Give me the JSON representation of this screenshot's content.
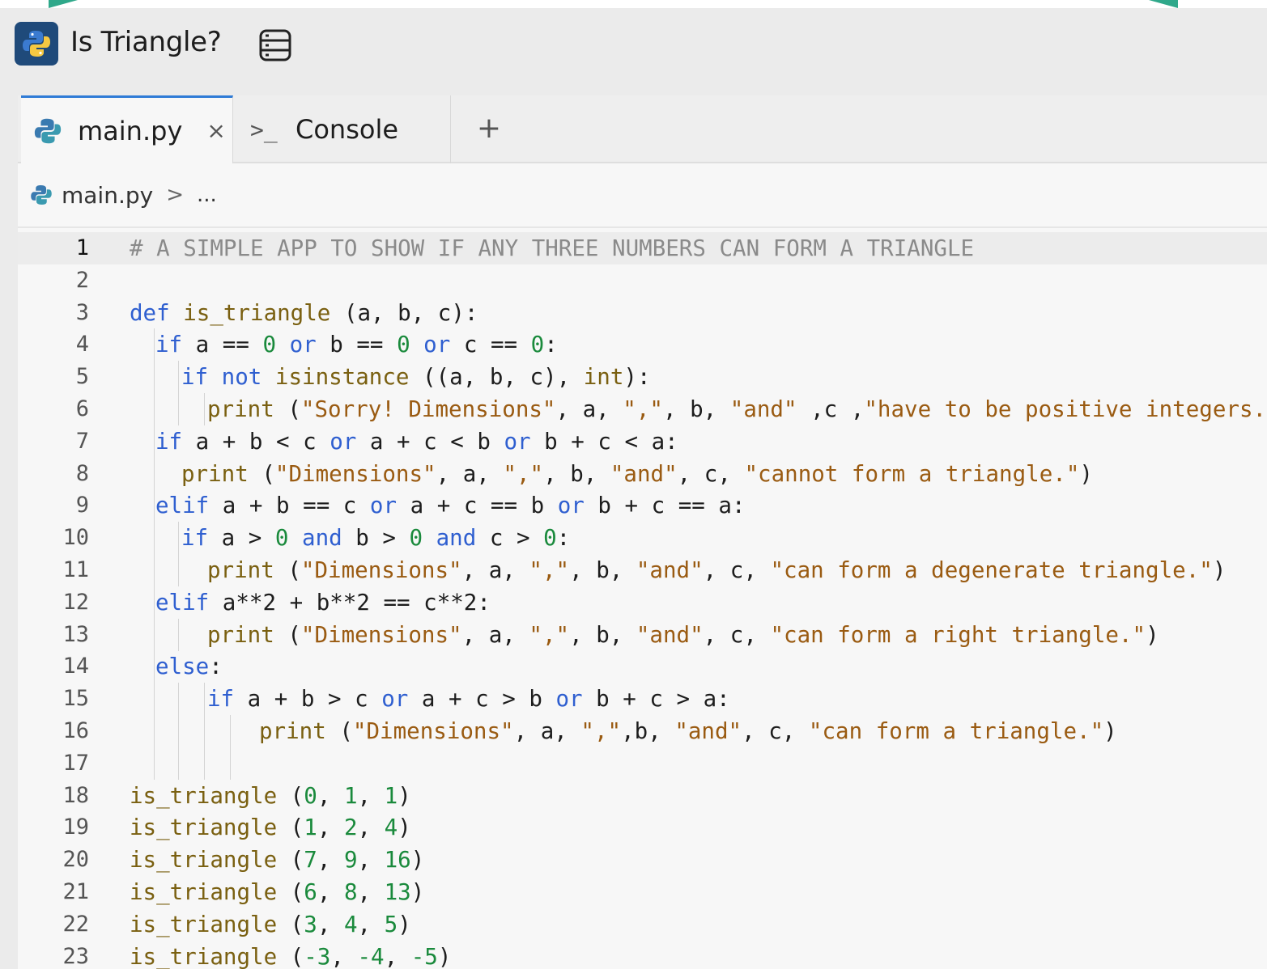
{
  "app": {
    "title": "Is Triangle?"
  },
  "tabs": [
    {
      "label": "main.py",
      "active": true,
      "close": "×"
    },
    {
      "label": "Console",
      "active": false,
      "icon_text": ">_"
    }
  ],
  "add_tab_label": "+",
  "breadcrumb": {
    "file": "main.py",
    "separator": ">",
    "more": "..."
  },
  "editor": {
    "current_line": 1,
    "lines": [
      {
        "n": "1",
        "indent": 0,
        "guides": 0,
        "tokens": [
          [
            "cm",
            "# A SIMPLE APP TO SHOW IF ANY THREE NUMBERS CAN FORM A TRIANGLE"
          ]
        ]
      },
      {
        "n": "2",
        "indent": 0,
        "guides": 0,
        "tokens": []
      },
      {
        "n": "3",
        "indent": 0,
        "guides": 0,
        "tokens": [
          [
            "kw",
            "def "
          ],
          [
            "fn",
            "is_triangle"
          ],
          [
            "op",
            " (a, b, c):"
          ]
        ]
      },
      {
        "n": "4",
        "indent": 1,
        "guides": 1,
        "tokens": [
          [
            "kw",
            "if "
          ],
          [
            "id",
            "a == "
          ],
          [
            "num",
            "0"
          ],
          [
            "kw",
            " or "
          ],
          [
            "id",
            "b == "
          ],
          [
            "num",
            "0"
          ],
          [
            "kw",
            " or "
          ],
          [
            "id",
            "c == "
          ],
          [
            "num",
            "0"
          ],
          [
            "op",
            ":"
          ]
        ]
      },
      {
        "n": "5",
        "indent": 2,
        "guides": 2,
        "tokens": [
          [
            "kw",
            "if not "
          ],
          [
            "fn",
            "isinstance"
          ],
          [
            "op",
            " ((a, b, c), "
          ],
          [
            "fn",
            "int"
          ],
          [
            "op",
            "):"
          ]
        ]
      },
      {
        "n": "6",
        "indent": 3,
        "guides": 3,
        "tokens": [
          [
            "fn",
            "print"
          ],
          [
            "op",
            " ("
          ],
          [
            "str",
            "\"Sorry! Dimensions\""
          ],
          [
            "op",
            ", a, "
          ],
          [
            "str",
            "\",\""
          ],
          [
            "op",
            ", b, "
          ],
          [
            "str",
            "\"and\""
          ],
          [
            "op",
            " ,c ,"
          ],
          [
            "str",
            "\"have to be positive integers.\""
          ],
          [
            "op",
            ")"
          ]
        ]
      },
      {
        "n": "7",
        "indent": 1,
        "guides": 1,
        "tokens": [
          [
            "kw",
            "if "
          ],
          [
            "id",
            "a + b < c "
          ],
          [
            "kw",
            "or "
          ],
          [
            "id",
            "a + c < b "
          ],
          [
            "kw",
            "or "
          ],
          [
            "id",
            "b + c < a:"
          ]
        ]
      },
      {
        "n": "8",
        "indent": 2,
        "guides": 1,
        "tokens": [
          [
            "fn",
            "print"
          ],
          [
            "op",
            " ("
          ],
          [
            "str",
            "\"Dimensions\""
          ],
          [
            "op",
            ", a, "
          ],
          [
            "str",
            "\",\""
          ],
          [
            "op",
            ", b, "
          ],
          [
            "str",
            "\"and\""
          ],
          [
            "op",
            ", c, "
          ],
          [
            "str",
            "\"cannot form a triangle.\""
          ],
          [
            "op",
            ")"
          ]
        ]
      },
      {
        "n": "9",
        "indent": 1,
        "guides": 1,
        "tokens": [
          [
            "kw",
            "elif "
          ],
          [
            "id",
            "a + b == c "
          ],
          [
            "kw",
            "or "
          ],
          [
            "id",
            "a + c == b "
          ],
          [
            "kw",
            "or "
          ],
          [
            "id",
            "b + c == a:"
          ]
        ]
      },
      {
        "n": "10",
        "indent": 2,
        "guides": 2,
        "tokens": [
          [
            "kw",
            "if "
          ],
          [
            "id",
            "a > "
          ],
          [
            "num",
            "0"
          ],
          [
            "kw",
            " and "
          ],
          [
            "id",
            "b > "
          ],
          [
            "num",
            "0"
          ],
          [
            "kw",
            " and "
          ],
          [
            "id",
            "c > "
          ],
          [
            "num",
            "0"
          ],
          [
            "op",
            ":"
          ]
        ]
      },
      {
        "n": "11",
        "indent": 3,
        "guides": 2,
        "tokens": [
          [
            "fn",
            "print"
          ],
          [
            "op",
            " ("
          ],
          [
            "str",
            "\"Dimensions\""
          ],
          [
            "op",
            ", a, "
          ],
          [
            "str",
            "\",\""
          ],
          [
            "op",
            ", b, "
          ],
          [
            "str",
            "\"and\""
          ],
          [
            "op",
            ", c, "
          ],
          [
            "str",
            "\"can form a degenerate triangle.\""
          ],
          [
            "op",
            ")"
          ]
        ]
      },
      {
        "n": "12",
        "indent": 1,
        "guides": 1,
        "tokens": [
          [
            "kw",
            "elif "
          ],
          [
            "id",
            "a**2 + b**2 == c**2:"
          ]
        ]
      },
      {
        "n": "13",
        "indent": 3,
        "guides": 2,
        "tokens": [
          [
            "fn",
            "print"
          ],
          [
            "op",
            " ("
          ],
          [
            "str",
            "\"Dimensions\""
          ],
          [
            "op",
            ", a, "
          ],
          [
            "str",
            "\",\""
          ],
          [
            "op",
            ", b, "
          ],
          [
            "str",
            "\"and\""
          ],
          [
            "op",
            ", c, "
          ],
          [
            "str",
            "\"can form a right triangle.\""
          ],
          [
            "op",
            ")"
          ]
        ]
      },
      {
        "n": "14",
        "indent": 1,
        "guides": 1,
        "tokens": [
          [
            "kw",
            "else"
          ],
          [
            "op",
            ":"
          ]
        ]
      },
      {
        "n": "15",
        "indent": 3,
        "guides": 3,
        "tokens": [
          [
            "kw",
            "if "
          ],
          [
            "id",
            "a + b > c "
          ],
          [
            "kw",
            "or "
          ],
          [
            "id",
            "a + c > b "
          ],
          [
            "kw",
            "or "
          ],
          [
            "id",
            "b + c > a:"
          ]
        ]
      },
      {
        "n": "16",
        "indent": 5,
        "guides": 4,
        "tokens": [
          [
            "fn",
            "print"
          ],
          [
            "op",
            " ("
          ],
          [
            "str",
            "\"Dimensions\""
          ],
          [
            "op",
            ", a, "
          ],
          [
            "str",
            "\",\""
          ],
          [
            "op",
            ",b, "
          ],
          [
            "str",
            "\"and\""
          ],
          [
            "op",
            ", c, "
          ],
          [
            "str",
            "\"can form a triangle.\""
          ],
          [
            "op",
            ")"
          ]
        ]
      },
      {
        "n": "17",
        "indent": 0,
        "guides": 4,
        "tokens": []
      },
      {
        "n": "18",
        "indent": 0,
        "guides": 0,
        "tokens": [
          [
            "fn",
            "is_triangle"
          ],
          [
            "op",
            " ("
          ],
          [
            "num",
            "0"
          ],
          [
            "op",
            ", "
          ],
          [
            "num",
            "1"
          ],
          [
            "op",
            ", "
          ],
          [
            "num",
            "1"
          ],
          [
            "op",
            ")"
          ]
        ]
      },
      {
        "n": "19",
        "indent": 0,
        "guides": 0,
        "tokens": [
          [
            "fn",
            "is_triangle"
          ],
          [
            "op",
            " ("
          ],
          [
            "num",
            "1"
          ],
          [
            "op",
            ", "
          ],
          [
            "num",
            "2"
          ],
          [
            "op",
            ", "
          ],
          [
            "num",
            "4"
          ],
          [
            "op",
            ")"
          ]
        ]
      },
      {
        "n": "20",
        "indent": 0,
        "guides": 0,
        "tokens": [
          [
            "fn",
            "is_triangle"
          ],
          [
            "op",
            " ("
          ],
          [
            "num",
            "7"
          ],
          [
            "op",
            ", "
          ],
          [
            "num",
            "9"
          ],
          [
            "op",
            ", "
          ],
          [
            "num",
            "16"
          ],
          [
            "op",
            ")"
          ]
        ]
      },
      {
        "n": "21",
        "indent": 0,
        "guides": 0,
        "tokens": [
          [
            "fn",
            "is_triangle"
          ],
          [
            "op",
            " ("
          ],
          [
            "num",
            "6"
          ],
          [
            "op",
            ", "
          ],
          [
            "num",
            "8"
          ],
          [
            "op",
            ", "
          ],
          [
            "num",
            "13"
          ],
          [
            "op",
            ")"
          ]
        ]
      },
      {
        "n": "22",
        "indent": 0,
        "guides": 0,
        "tokens": [
          [
            "fn",
            "is_triangle"
          ],
          [
            "op",
            " ("
          ],
          [
            "num",
            "3"
          ],
          [
            "op",
            ", "
          ],
          [
            "num",
            "4"
          ],
          [
            "op",
            ", "
          ],
          [
            "num",
            "5"
          ],
          [
            "op",
            ")"
          ]
        ]
      },
      {
        "n": "23",
        "indent": 0,
        "guides": 0,
        "tokens": [
          [
            "fn",
            "is_triangle"
          ],
          [
            "op",
            " ("
          ],
          [
            "num",
            "-3"
          ],
          [
            "op",
            ", "
          ],
          [
            "num",
            "-4"
          ],
          [
            "op",
            ", "
          ],
          [
            "num",
            "-5"
          ],
          [
            "op",
            ")"
          ]
        ]
      }
    ]
  },
  "colors": {
    "accent": "#2f7bd6",
    "keyword": "#2f5fd0",
    "string": "#9a5b12",
    "number": "#1a8a3c",
    "function": "#7a6011",
    "comment": "#8a8a8a",
    "decoration": "#2fa88a"
  },
  "icons": {
    "app": "python-logo-icon",
    "menu": "list-menu-icon",
    "file": "python-file-icon",
    "console": "terminal-prompt-icon"
  }
}
